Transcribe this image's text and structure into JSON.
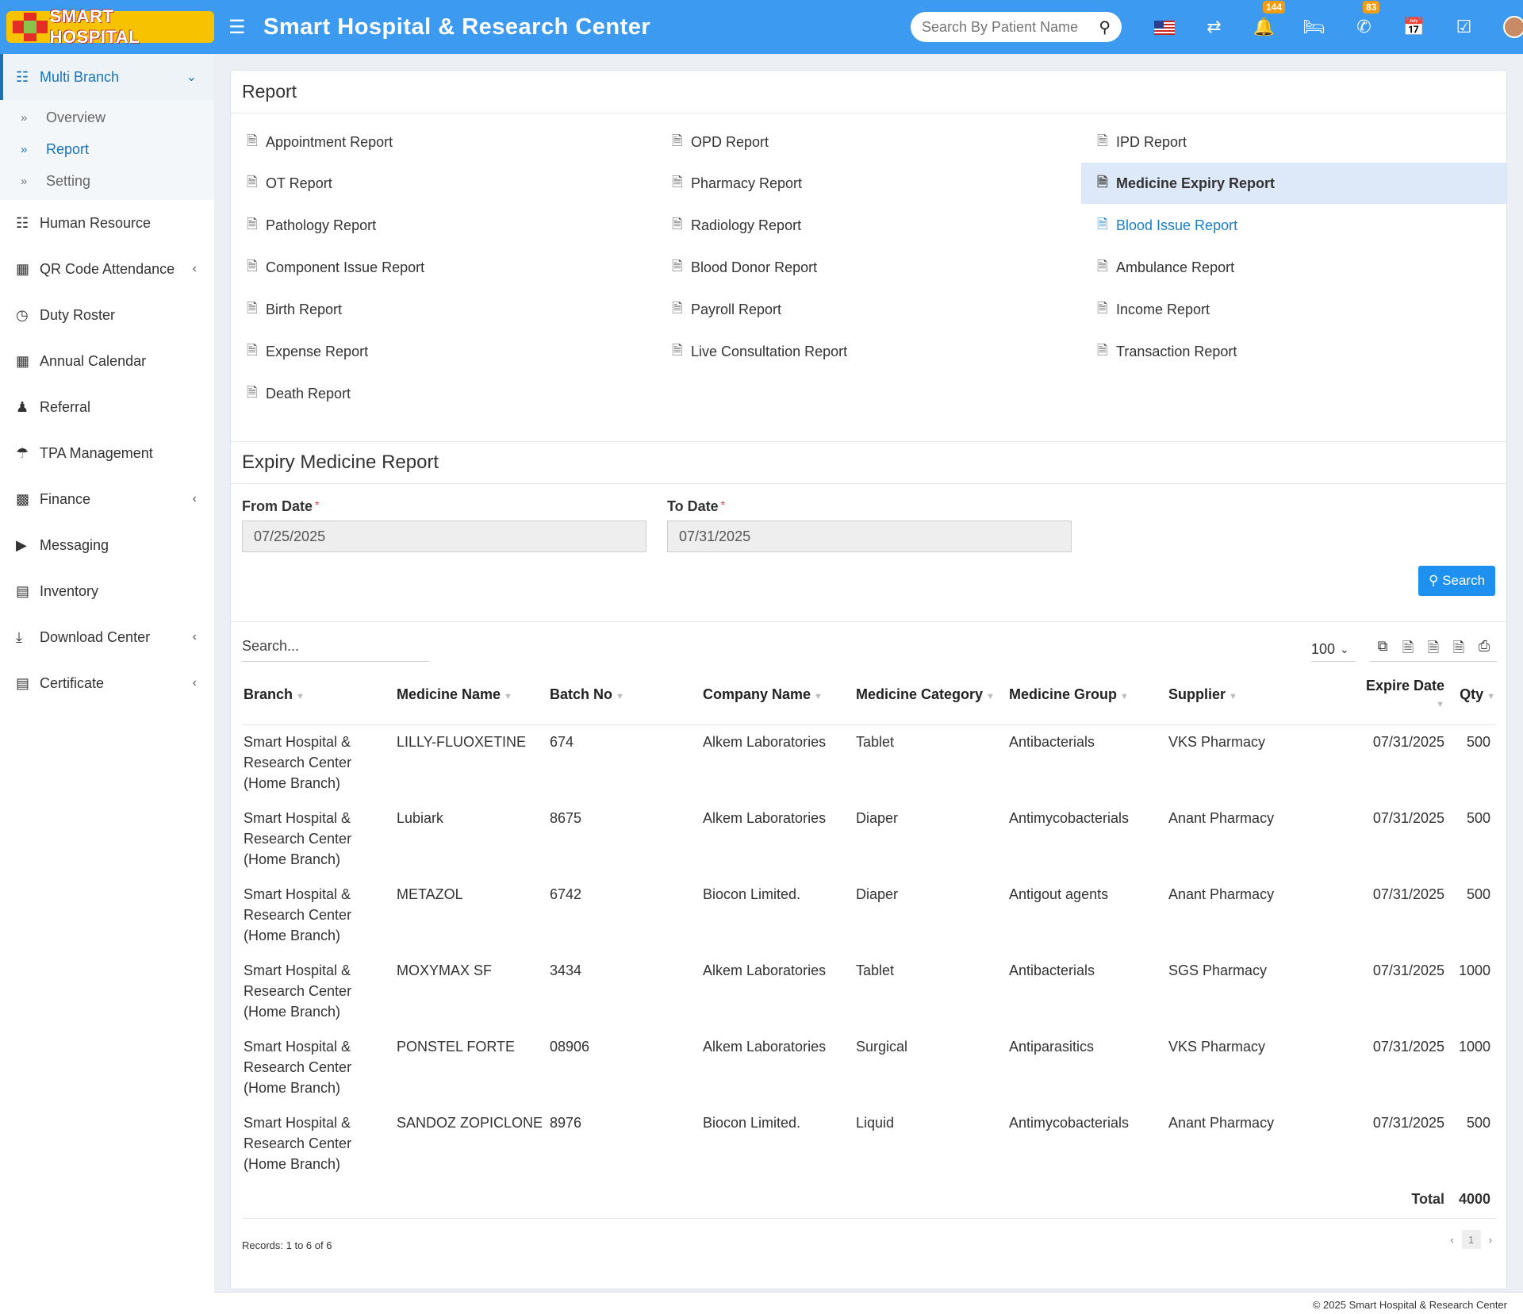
{
  "header": {
    "logo_text": "SMART HOSPITAL",
    "title": "Smart Hospital & Research Center",
    "search_placeholder": "Search By Patient Name",
    "notification_count": "144",
    "whatsapp_count": "83"
  },
  "sidebar": {
    "items": [
      {
        "label": "Multi Branch",
        "icon": "sitemap-icon"
      },
      {
        "label": "Human Resource",
        "icon": "sitemap-icon"
      },
      {
        "label": "QR Code Attendance",
        "icon": "qrcode-icon"
      },
      {
        "label": "Duty Roster",
        "icon": "clock-icon"
      },
      {
        "label": "Annual Calendar",
        "icon": "calculator-icon"
      },
      {
        "label": "Referral",
        "icon": "users-icon"
      },
      {
        "label": "TPA Management",
        "icon": "umbrella-icon"
      },
      {
        "label": "Finance",
        "icon": "money-icon"
      },
      {
        "label": "Messaging",
        "icon": "bullhorn-icon"
      },
      {
        "label": "Inventory",
        "icon": "inventory-icon"
      },
      {
        "label": "Download Center",
        "icon": "download-icon"
      },
      {
        "label": "Certificate",
        "icon": "certificate-icon"
      }
    ],
    "sub_items": [
      "Overview",
      "Report",
      "Setting"
    ]
  },
  "report_section": {
    "title": "Report",
    "reports": [
      "Appointment Report",
      "OPD Report",
      "IPD Report",
      "OT Report",
      "Pharmacy Report",
      "Medicine Expiry Report",
      "Pathology Report",
      "Radiology Report",
      "Blood Issue Report",
      "Component Issue Report",
      "Blood Donor Report",
      "Ambulance Report",
      "Birth Report",
      "Payroll Report",
      "Income Report",
      "Expense Report",
      "Live Consultation Report",
      "Transaction Report",
      "Death Report"
    ]
  },
  "expiry": {
    "title": "Expiry Medicine Report",
    "from_label": "From Date",
    "from_value": "07/25/2025",
    "to_label": "To Date",
    "to_value": "07/31/2025",
    "required_mark": "*",
    "search_button": "Search"
  },
  "table": {
    "search_placeholder": "Search...",
    "page_size": "100",
    "columns": [
      "Branch",
      "Medicine Name",
      "Batch No",
      "Company Name",
      "Medicine Category",
      "Medicine Group",
      "Supplier",
      "Expire Date",
      "Qty"
    ],
    "rows": [
      {
        "branch": "Smart Hospital & Research Center (Home Branch)",
        "medicine": "LILLY-FLUOXETINE",
        "batch": "674",
        "company": "Alkem Laboratories",
        "category": "Tablet",
        "group": "Antibacterials",
        "supplier": "VKS Pharmacy",
        "expire": "07/31/2025",
        "qty": "500"
      },
      {
        "branch": "Smart Hospital & Research Center (Home Branch)",
        "medicine": "Lubiark",
        "batch": "8675",
        "company": "Alkem Laboratories",
        "category": "Diaper",
        "group": "Antimycobacterials",
        "supplier": "Anant Pharmacy",
        "expire": "07/31/2025",
        "qty": "500"
      },
      {
        "branch": "Smart Hospital & Research Center (Home Branch)",
        "medicine": "METAZOL",
        "batch": "6742",
        "company": "Biocon Limited.",
        "category": "Diaper",
        "group": "Antigout agents",
        "supplier": "Anant Pharmacy",
        "expire": "07/31/2025",
        "qty": "500"
      },
      {
        "branch": "Smart Hospital & Research Center (Home Branch)",
        "medicine": "MOXYMAX SF",
        "batch": "3434",
        "company": "Alkem Laboratories",
        "category": "Tablet",
        "group": "Antibacterials",
        "supplier": "SGS Pharmacy",
        "expire": "07/31/2025",
        "qty": "1000"
      },
      {
        "branch": "Smart Hospital & Research Center (Home Branch)",
        "medicine": "PONSTEL FORTE",
        "batch": "08906",
        "company": "Alkem Laboratories",
        "category": "Surgical",
        "group": "Antiparasitics",
        "supplier": "VKS Pharmacy",
        "expire": "07/31/2025",
        "qty": "1000"
      },
      {
        "branch": "Smart Hospital & Research Center (Home Branch)",
        "medicine": "SANDOZ ZOPICLONE",
        "batch": "8976",
        "company": "Biocon Limited.",
        "category": "Liquid",
        "group": "Antimycobacterials",
        "supplier": "Anant Pharmacy",
        "expire": "07/31/2025",
        "qty": "500"
      }
    ],
    "total_label": "Total",
    "total_value": "4000",
    "records_text": "Records: 1 to 6 of 6",
    "current_page": "1"
  },
  "footer": {
    "copyright": "© 2025 Smart Hospital & Research Center"
  },
  "colors": {
    "header": "#3c9bf0",
    "accent": "#1a73b8",
    "button": "#1e90f0",
    "active_report_bg": "#dde9f8"
  }
}
